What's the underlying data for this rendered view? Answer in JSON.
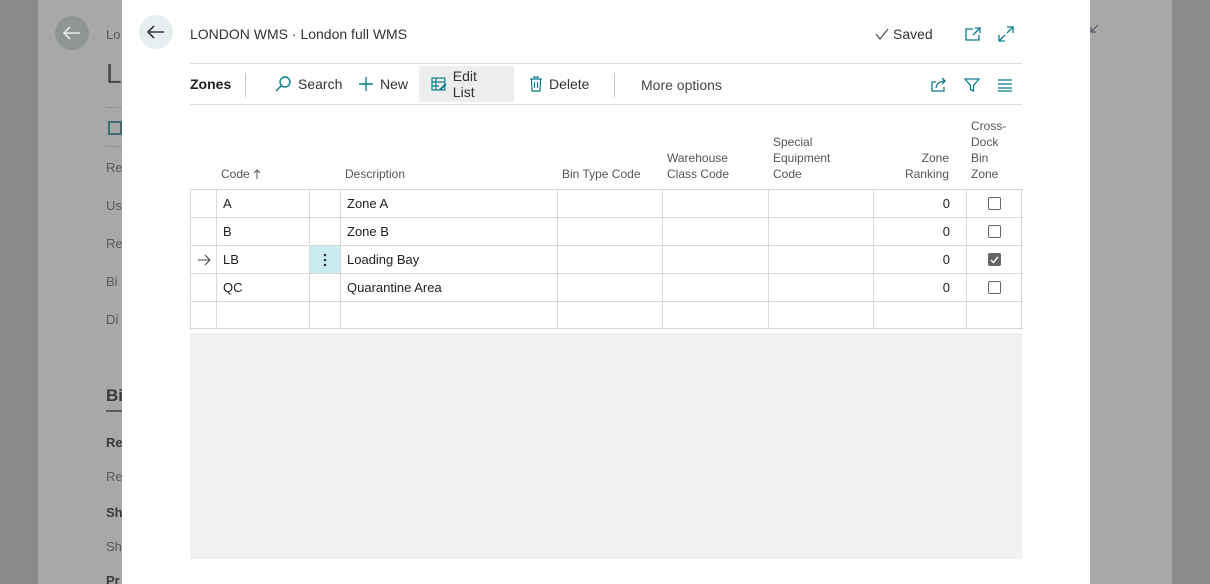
{
  "background": {
    "tab_label": "Lo",
    "big_title": "L",
    "fields": [
      "Re",
      "Us",
      "Re",
      "Bi",
      "Di"
    ],
    "section_title": "Bi",
    "section_fields": [
      {
        "text": "Re",
        "bold": true
      },
      {
        "text": "Re",
        "bold": false
      },
      {
        "text": "Sh",
        "bold": true
      },
      {
        "text": "Sh",
        "bold": false
      },
      {
        "text": "Pr",
        "bold": true
      }
    ]
  },
  "dialog": {
    "title": "LONDON WMS · London full WMS",
    "saved_label": "Saved"
  },
  "actionbar": {
    "page_name": "Zones",
    "search_label": "Search",
    "new_label": "New",
    "edit_list_label": "Edit List",
    "delete_label": "Delete",
    "more_options_label": "More options"
  },
  "columns": {
    "code": "Code",
    "description": "Description",
    "bin_type_code": "Bin Type Code",
    "warehouse_class_code_1": "Warehouse",
    "warehouse_class_code_2": "Class Code",
    "special_equipment_1": "Special",
    "special_equipment_2": "Equipment",
    "special_equipment_3": "Code",
    "zone_ranking_1": "Zone",
    "zone_ranking_2": "Ranking",
    "cross_dock_1": "Cross-",
    "cross_dock_2": "Dock",
    "cross_dock_3": "Bin",
    "cross_dock_4": "Zone"
  },
  "rows": [
    {
      "code": "A",
      "description": "Zone A",
      "bin_type_code": "",
      "warehouse_class_code": "",
      "special_equipment_code": "",
      "zone_ranking": "0",
      "cross_dock": false
    },
    {
      "code": "B",
      "description": "Zone B",
      "bin_type_code": "",
      "warehouse_class_code": "",
      "special_equipment_code": "",
      "zone_ranking": "0",
      "cross_dock": false
    },
    {
      "code": "LB",
      "description": "Loading Bay",
      "bin_type_code": "",
      "warehouse_class_code": "",
      "special_equipment_code": "",
      "zone_ranking": "0",
      "cross_dock": true
    },
    {
      "code": "QC",
      "description": "Quarantine Area",
      "bin_type_code": "",
      "warehouse_class_code": "",
      "special_equipment_code": "",
      "zone_ranking": "0",
      "cross_dock": false
    }
  ],
  "colors": {
    "accent": "#00796b",
    "selected_cell": "#c8ecef",
    "icon": "#0a7c8c"
  }
}
